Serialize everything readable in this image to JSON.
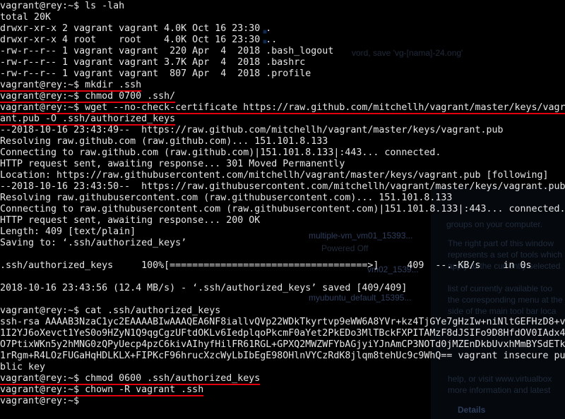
{
  "background_color": "#000000",
  "text_color": "#e6e6e6",
  "highlight_color": "#e3000f",
  "lines": [
    "vagrant@rey:~$ ls -lah",
    "total 20K",
    "drwxr-xr-x 2 vagrant vagrant 4.0K Oct 16 23:30 .",
    "drwxr-xr-x 4 root    root    4.0K Oct 16 23:30 ..",
    "-rw-r--r-- 1 vagrant vagrant  220 Apr  4  2018 .bash_logout",
    "-rw-r--r-- 1 vagrant vagrant 3.7K Apr  4  2018 .bashrc",
    "-rw-r--r-- 1 vagrant vagrant  807 Apr  4  2018 .profile",
    "vagrant@rey:~$ mkdir .ssh",
    "vagrant@rey:~$ chmod 0700 .ssh/",
    "vagrant@rey:~$ wget --no-check-certificate https://raw.github.com/mitchellh/vagrant/master/keys/vagr",
    "ant.pub -O .ssh/authorized_keys",
    "--2018-10-16 23:43:49--  https://raw.github.com/mitchellh/vagrant/master/keys/vagrant.pub",
    "Resolving raw.github.com (raw.github.com)... 151.101.8.133",
    "Connecting to raw.github.com (raw.github.com)|151.101.8.133|:443... connected.",
    "HTTP request sent, awaiting response... 301 Moved Permanently",
    "Location: https://raw.githubusercontent.com/mitchellh/vagrant/master/keys/vagrant.pub [following]",
    "--2018-10-16 23:43:50--  https://raw.githubusercontent.com/mitchellh/vagrant/master/keys/vagrant.pub",
    "Resolving raw.githubusercontent.com (raw.githubusercontent.com)... 151.101.8.133",
    "Connecting to raw.githubusercontent.com (raw.githubusercontent.com)|151.101.8.133|:443... connected.",
    "HTTP request sent, awaiting response... 200 OK",
    "Length: 409 [text/plain]",
    "Saving to: ‘.ssh/authorized_keys’",
    "",
    ".ssh/authorized_keys     100%[===================================>]     409  --.-KB/s    in 0s",
    "",
    "2018-10-16 23:43:56 (12.4 MB/s) - ‘.ssh/authorized_keys’ saved [409/409]",
    "",
    "vagrant@rey:~$ cat .ssh/authorized_keys",
    "ssh-rsa AAAAB3NzaC1yc2EAAAABIwAAAQEA6NF8iallvQVp22WDkTkyrtvp9eWW6A8YVr+kz4TjGYe7gHzIw+niNltGEFHzD8+v",
    "1I2YJ6oXevct1YeS0o9HZyN1Q9qgCgzUFtdOKLv6IedplqoPkcmF0aYet2PkEDo3MlTBckFXPITAMzF8dJSIFo9D8HfdOV0IAdx4",
    "O7PtixWKn5y2hMNG0zQPyUecp4pzC6kivAIhyfHilFR61RGL+GPXQ2MWZWFYbAGjyiYJnAmCP3NOTd0jMZEnDkbUvxhMmBYSdETk",
    "1rRgm+R4LOzFUGaHqHDLKLX+FIPKcF96hrucXzcWyLbIbEgE98OHlnVYCzRdK8jlqm8tehUc9c9WhQ== vagrant insecure pu",
    "blic key",
    "vagrant@rey:~$ chmod 0600 .ssh/authorized_keys",
    "vagrant@rey:~$ chown -R vagrant .ssh",
    "vagrant@rey:~$ "
  ],
  "ghosts": {
    "save_hint": "vord, save 'vg-[nama]-24.ong'",
    "vm1_name": "multiple-vm_vm01_15393...",
    "vm1_state": "Powered Off",
    "vm2_name": "vm02_1539...",
    "vm3_name": "myubuntu_default_15395...",
    "groups_text": "groups on your computer.",
    "right_p1": "The right part of this window",
    "right_p2": "represents a set of tools which",
    "right_p3": "apply to the currently selected",
    "right_p4": "list of currently available too",
    "right_p5": "the corresponding menu at the",
    "right_p6": "side of the main tool bar loca",
    "help_text": "help, or visit www.virtualbox",
    "more_text": "more information and latest",
    "details": "Details"
  }
}
